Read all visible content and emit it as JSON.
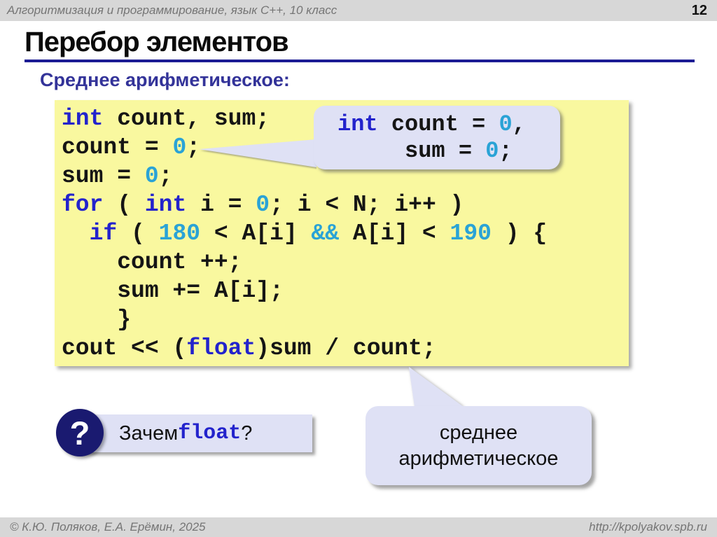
{
  "header": {
    "course_title": "Алгоритмизация и программирование, язык C++, 10 класс",
    "slide_number": "12"
  },
  "title": "Перебор элементов",
  "subtitle": "Среднее арифметическое:",
  "code": {
    "lines": [
      [
        {
          "t": "int",
          "c": "kw"
        },
        {
          "t": " count, sum;"
        }
      ],
      [
        {
          "t": "count = "
        },
        {
          "t": "0",
          "c": "num"
        },
        {
          "t": ";"
        }
      ],
      [
        {
          "t": "sum = "
        },
        {
          "t": "0",
          "c": "num"
        },
        {
          "t": ";"
        }
      ],
      [
        {
          "t": "for",
          "c": "kw"
        },
        {
          "t": " ( "
        },
        {
          "t": "int",
          "c": "kw"
        },
        {
          "t": " i = "
        },
        {
          "t": "0",
          "c": "num"
        },
        {
          "t": "; i < N; i++ )"
        }
      ],
      [
        {
          "t": "  "
        },
        {
          "t": "if",
          "c": "kw"
        },
        {
          "t": " ( "
        },
        {
          "t": "180",
          "c": "num"
        },
        {
          "t": " < A[i] "
        },
        {
          "t": "&&",
          "c": "num"
        },
        {
          "t": " A[i] < "
        },
        {
          "t": "190",
          "c": "num"
        },
        {
          "t": " ) {"
        }
      ],
      [
        {
          "t": "    count ++;"
        }
      ],
      [
        {
          "t": "    sum += A[i];"
        }
      ],
      [
        {
          "t": "    }"
        }
      ],
      [
        {
          "t": "cout << ("
        },
        {
          "t": "float",
          "c": "kw"
        },
        {
          "t": ")sum / count;"
        }
      ]
    ]
  },
  "callout_init": {
    "lines": [
      [
        {
          "t": "int",
          "c": "kw"
        },
        {
          "t": " count = "
        },
        {
          "t": "0",
          "c": "num"
        },
        {
          "t": ","
        }
      ],
      [
        {
          "t": "     sum = "
        },
        {
          "t": "0",
          "c": "num"
        },
        {
          "t": ";"
        }
      ]
    ]
  },
  "question": {
    "icon": "?",
    "prefix": "Зачем ",
    "keyword": "float",
    "suffix": "?"
  },
  "callout_avg": {
    "line1": "среднее",
    "line2": "арифметическое"
  },
  "footer": {
    "authors": "© К.Ю. Поляков, Е.А. Ерёмин, 2025",
    "site": "http://kpolyakov.spb.ru"
  },
  "colors": {
    "keyword": "#2323cc",
    "number": "#2aa3d6",
    "title_rule": "#1c1c94",
    "subtitle": "#333399",
    "code_bg": "#f9f89f",
    "bubble_bg": "#dfe1f5",
    "bar_bg": "#d7d7d7",
    "circle_bg": "#1a1a70"
  }
}
